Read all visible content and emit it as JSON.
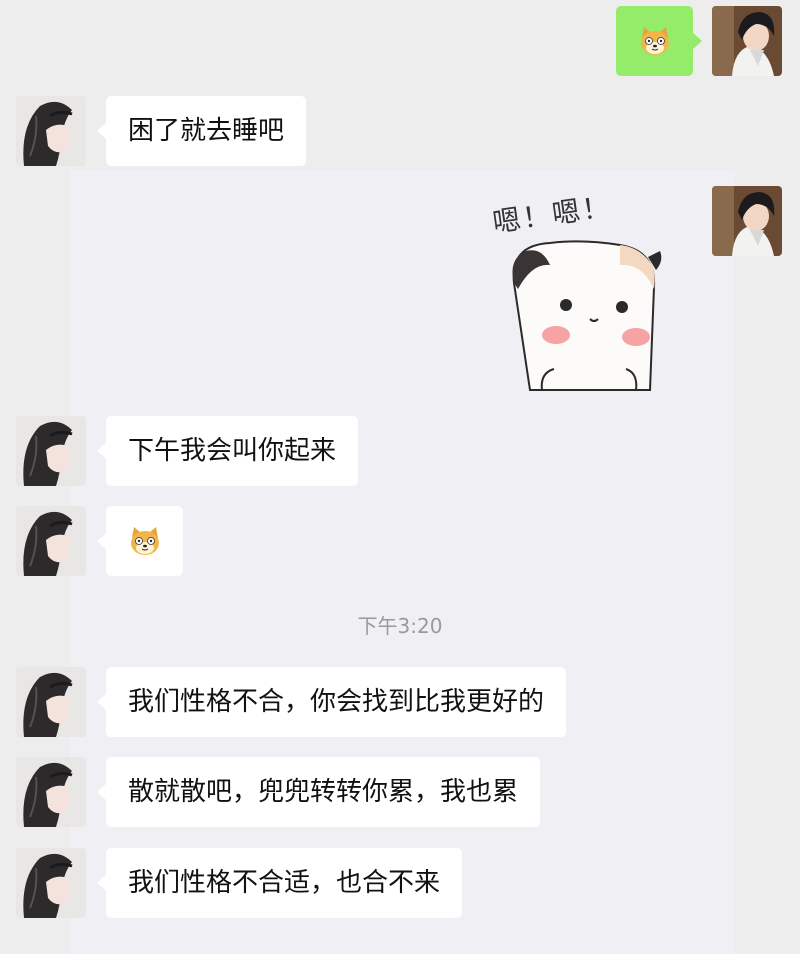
{
  "messages": [
    {
      "side": "out",
      "type": "emoji",
      "emoji": "doge-emoji"
    },
    {
      "side": "in",
      "type": "text",
      "text": "困了就去睡吧"
    },
    {
      "side": "out",
      "type": "sticker",
      "caption": "嗯！嗯！"
    },
    {
      "side": "in",
      "type": "text",
      "text": "下午我会叫你起来"
    },
    {
      "side": "in",
      "type": "emoji",
      "emoji": "doge-emoji"
    },
    {
      "side": "in",
      "type": "text",
      "text": "我们性格不合，你会找到比我更好的"
    },
    {
      "side": "in",
      "type": "text",
      "text": "散就散吧，兜兜转转你累，我也累"
    },
    {
      "side": "in",
      "type": "text",
      "text": "我们性格不合适，也合不来"
    }
  ],
  "timestamp": "下午3:20",
  "colors": {
    "page_bg": "#ededed",
    "chat_bg": "#efeff4",
    "bubble_in": "#ffffff",
    "bubble_out": "#95ec69",
    "timestamp_text": "#9a9a9a"
  }
}
